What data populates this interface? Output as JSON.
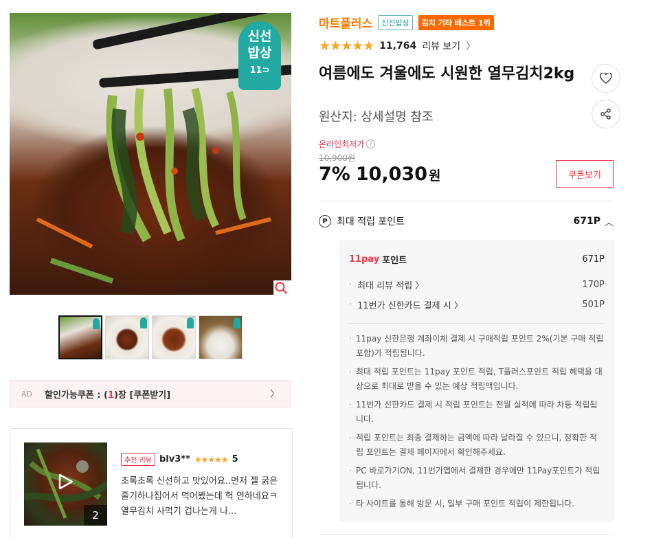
{
  "gallery": {
    "badge_line1": "신선",
    "badge_line2": "밥상",
    "badge_line3": "11⊃",
    "thumbnails": [
      "thumb-1",
      "thumb-2",
      "thumb-3",
      "thumb-4"
    ]
  },
  "ad": {
    "tag": "AD",
    "text_prefix": "할인가능쿠폰 : (",
    "count": "1",
    "text_suffix": ")장 [쿠폰받기]"
  },
  "review": {
    "badge": "추천 리뷰",
    "user": "blv3**",
    "stars": "★★★★★",
    "score": "5",
    "text": "초록초록 신선하고 맛있어요..먼저 젤 굵은 줄기하나집어서 먹어봤는데 헉 연하네요ㅋ열무김치 사먹기 겁나는게 나...",
    "image_count": "2"
  },
  "product": {
    "brand": "마트플러스",
    "tag_fresh": "신선밥상",
    "tag_best": "김치 기타 베스트 1위",
    "stars": "★★★★★",
    "rating": 4.5,
    "review_count": "11,764",
    "review_link": "리뷰 보기",
    "title": "여름에도 겨울에도 시원한 열무김치2kg",
    "origin": "원산지: 상세설명 참조",
    "lowest_label": "온라인최저가",
    "original_price": "10,900원",
    "discount": "7%",
    "price": "10,030",
    "currency": "원",
    "coupon_button": "쿠폰보기"
  },
  "points": {
    "label": "최대 적립 포인트",
    "value": "671P",
    "pay_logo": "11pay",
    "pay_label": "포인트",
    "pay_value": "671P",
    "sub": [
      {
        "label": "최대 리뷰 적립",
        "value": "170P"
      },
      {
        "label": "11번가 신한카드 결제 시",
        "value": "501P"
      }
    ],
    "notes": [
      "11pay 신한은행 계좌이체 결제 시 구매적립 포인트 2%(기본 구매 적립 포함)가 적립됩니다.",
      "최대 적립 포인트는 11pay 포인트 적립, T플러스포인트 적립 혜택을 대상으로 최대로 받을 수 있는 예상 적립액입니다.",
      "11번가 신한카드 결제 시 적립 포인트는 전월 실적에 따라 차등 적립됩니다.",
      "적립 포인트는 최종 결제하는 금액에 따라 달라질 수 있으니, 정확한 적립 포인트는 결제 페이지에서 확인해주세요.",
      "PC 바로가기ON, 11번가앱에서 결제한 경우에만 11Pay포인트가 적립 됩니다.",
      "타 사이트를 통해 방문 시, 일부 구매 포인트 적립이 제한됩니다."
    ]
  },
  "colors": {
    "accent_red": "#f43142",
    "brand_orange": "#ff7a00",
    "teal": "#22a9a1",
    "star": "#f5a623"
  }
}
